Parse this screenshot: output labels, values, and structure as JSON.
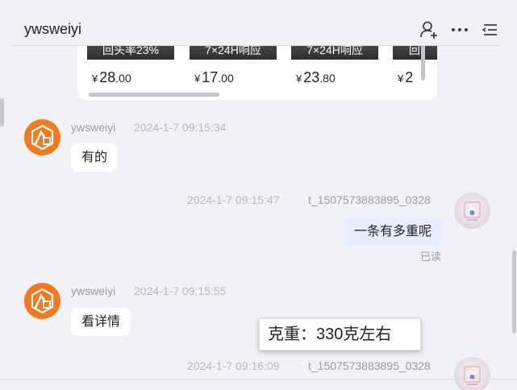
{
  "header": {
    "title": "ywsweiyi",
    "icons": [
      "user-add-icon",
      "more-icon",
      "menu-list-icon"
    ]
  },
  "products": [
    {
      "tag": "回头率23%",
      "currency": "¥",
      "int": "28",
      "dec": ".00"
    },
    {
      "tag": "7×24H响应",
      "currency": "¥",
      "int": "17",
      "dec": ".00"
    },
    {
      "tag": "7×24H响应",
      "currency": "¥",
      "int": "23",
      "dec": ".80"
    },
    {
      "tag": "回",
      "currency": "¥",
      "int": "2",
      "dec": ""
    }
  ],
  "messages": [
    {
      "side": "in",
      "sender": "ywsweiyi",
      "time": "2024-1-7 09:15:34",
      "text": "有的"
    },
    {
      "side": "out",
      "sender": "t_1507573883895_0328",
      "time": "2024-1-7 09:15:47",
      "text": "一条有多重呢",
      "status": "已读"
    },
    {
      "side": "in",
      "sender": "ywsweiyi",
      "time": "2024-1-7 09:15:55",
      "text": "看详情"
    },
    {
      "side": "out",
      "sender": "t_1507573883895_0328",
      "time": "2024-1-7 09:16:09"
    }
  ],
  "tooltip": {
    "text": "克重：330克左右"
  },
  "colors": {
    "brand_orange": "#f07a1d",
    "outgoing_bubble": "#e6eeff",
    "page_bg": "#f1f2f6"
  }
}
